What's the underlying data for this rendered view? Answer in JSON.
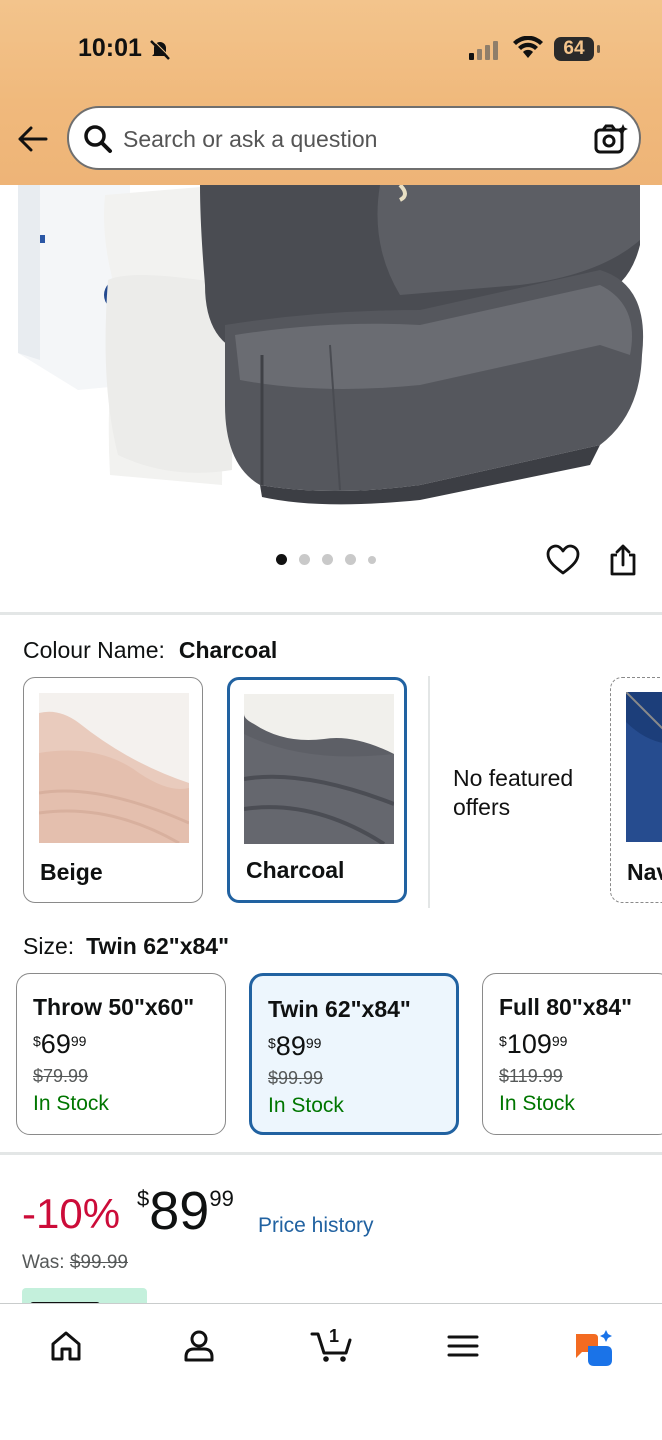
{
  "status": {
    "time": "10:01",
    "battery": "64",
    "battery_level": 0.64
  },
  "search": {
    "placeholder": "Search or ask a question"
  },
  "gallery": {
    "image_count": 5,
    "active_index": 0
  },
  "colour": {
    "label": "Colour Name:",
    "selected": "Charcoal",
    "options": [
      {
        "name": "Beige"
      },
      {
        "name": "Charcoal"
      },
      {
        "name": "No featured offers"
      },
      {
        "name": "Nav"
      }
    ]
  },
  "size": {
    "label": "Size:",
    "selected": "Twin 62\"x84\"",
    "options": [
      {
        "name": "Throw 50\"x60\"",
        "price_whole": "69",
        "price_frac": "99",
        "was": "$79.99",
        "stock": "In Stock"
      },
      {
        "name": "Twin 62\"x84\"",
        "price_whole": "89",
        "price_frac": "99",
        "was": "$99.99",
        "stock": "In Stock"
      },
      {
        "name": "Full 80\"x84\"",
        "price_whole": "109",
        "price_frac": "99",
        "was": "$119.99",
        "stock": "In Stock"
      }
    ]
  },
  "pricing": {
    "discount": "-10%",
    "currency": "$",
    "whole": "89",
    "fraction": "99",
    "history_link": "Price history",
    "was_label": "Was:",
    "was_price": "$99.99"
  },
  "tabbar": {
    "items": [
      "home",
      "account",
      "cart",
      "menu",
      "rufus"
    ],
    "cart_count": "1"
  }
}
